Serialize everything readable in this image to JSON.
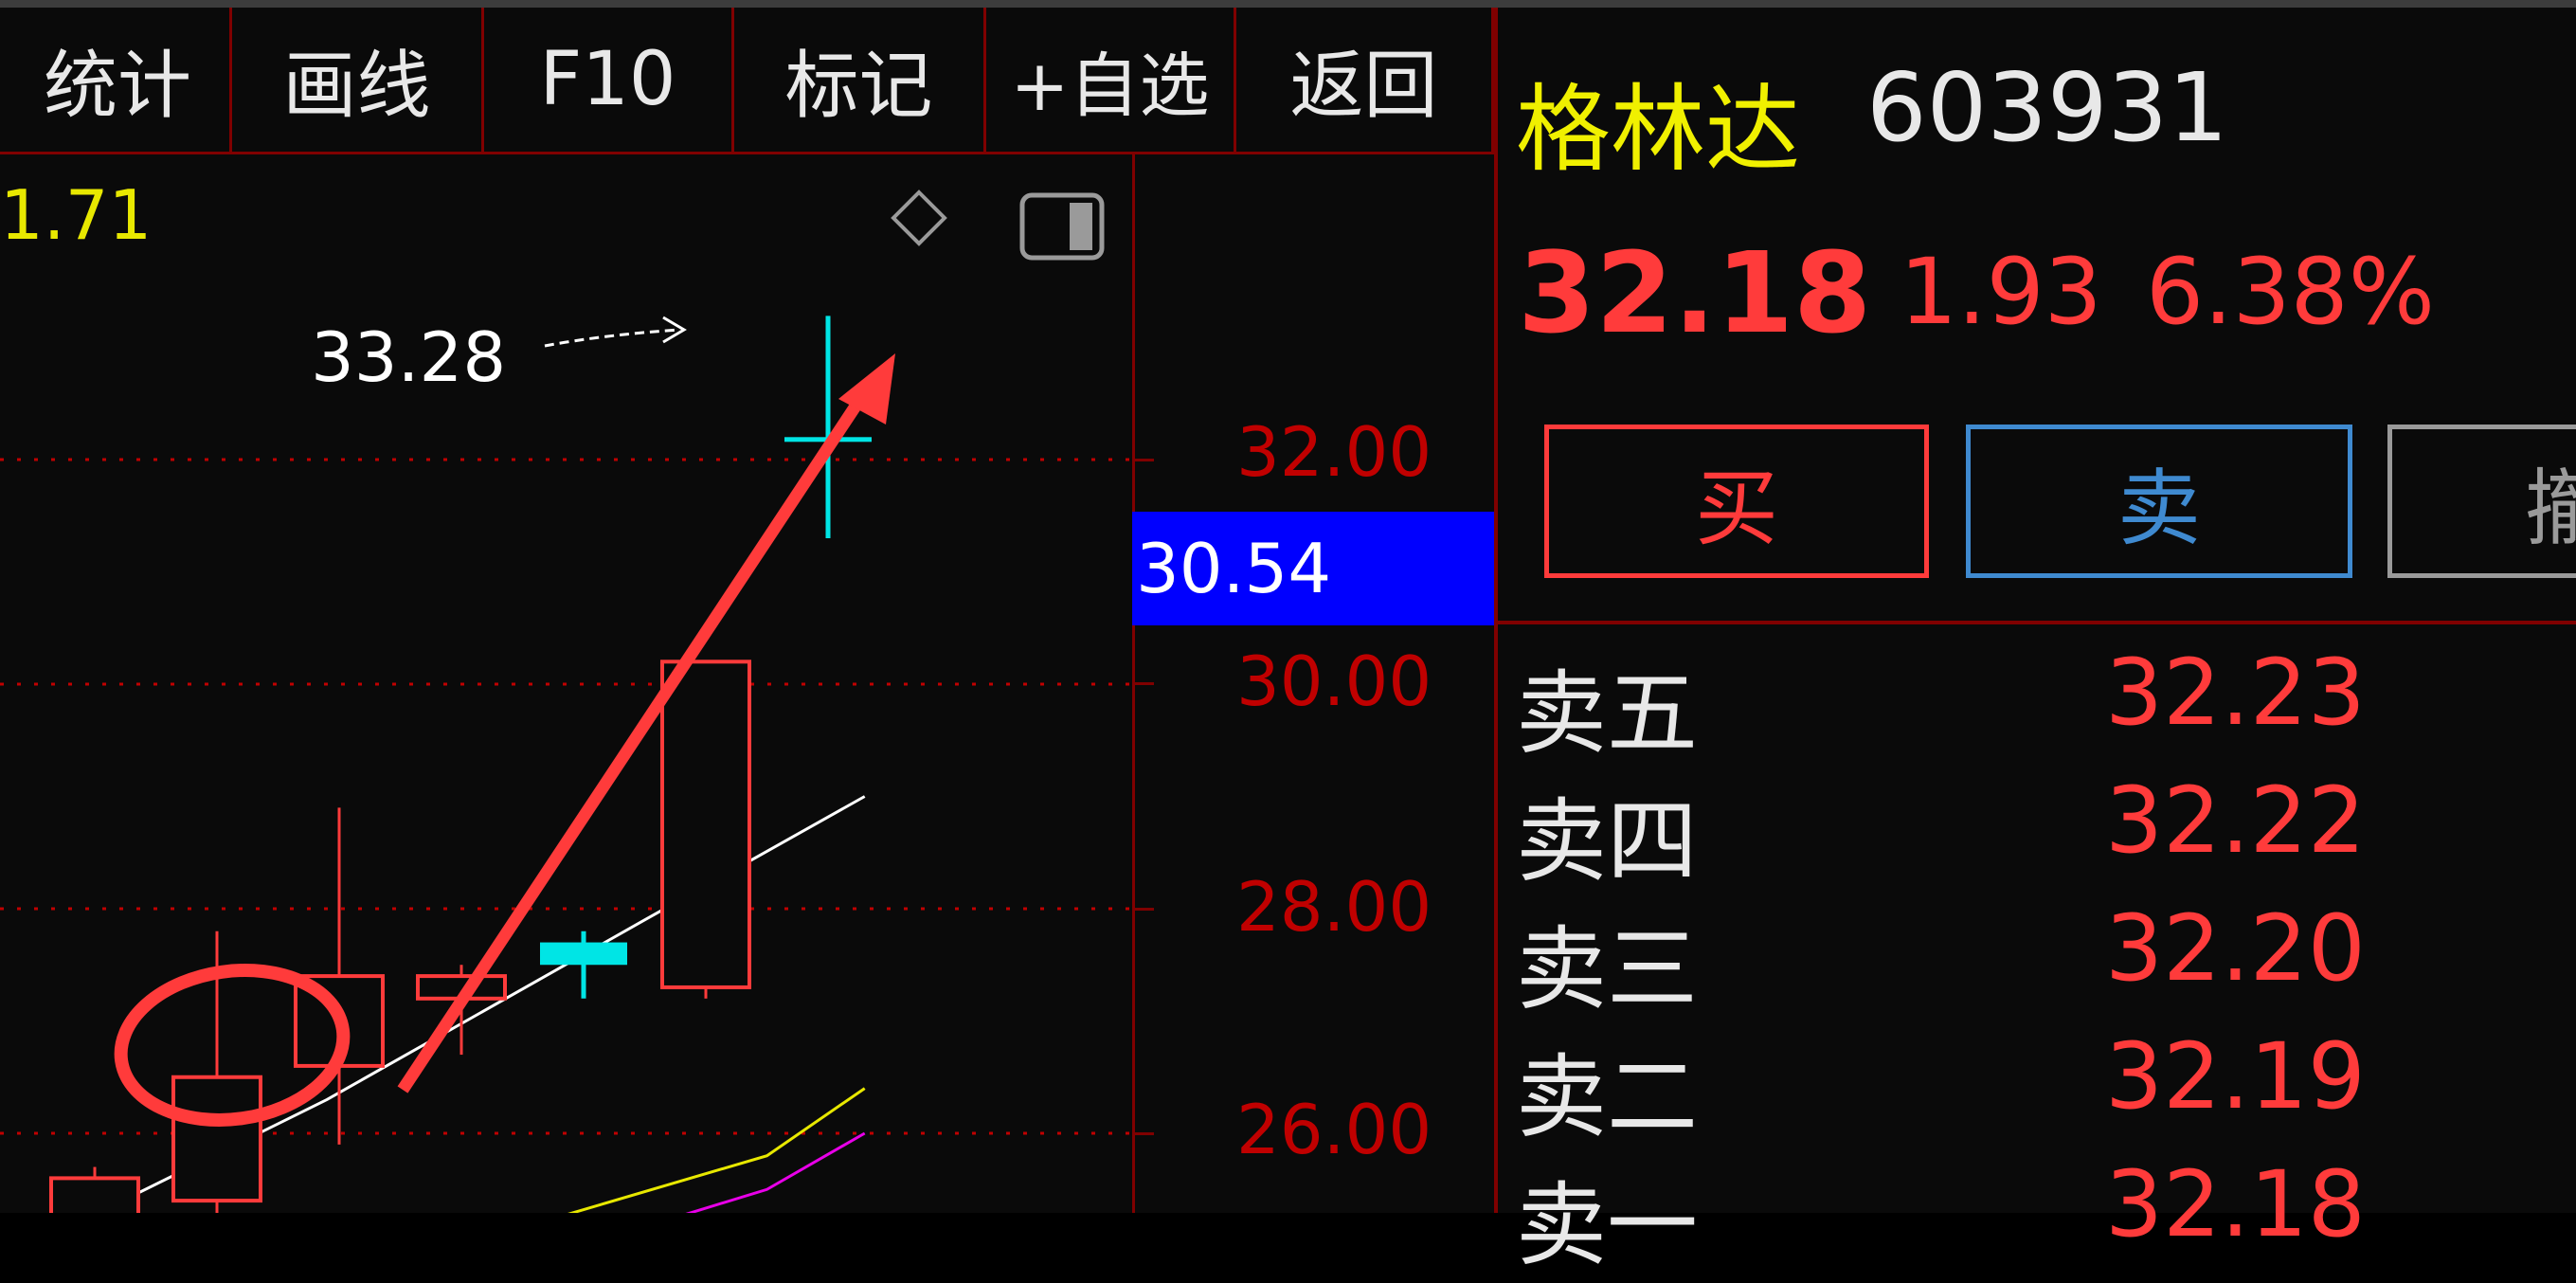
{
  "toolbar": {
    "items": [
      "统计",
      "画线",
      "F10",
      "标记",
      "+自选",
      "返回"
    ]
  },
  "chart": {
    "ma_label": "1.71",
    "high_label": "33.28",
    "current_price_box": "30.54",
    "axis_ticks": [
      "32.00",
      "30.00",
      "28.00",
      "26.00"
    ],
    "icons": [
      "diamond-icon",
      "panel-toggle-icon"
    ]
  },
  "chart_data": {
    "type": "candlestick",
    "ylim": [
      25.4,
      34.3
    ],
    "candles": [
      {
        "open": 25.0,
        "close": 25.6,
        "high": 25.7,
        "low": 24.8,
        "color": "red"
      },
      {
        "open": 25.4,
        "close": 26.5,
        "high": 27.8,
        "low": 25.2,
        "color": "red"
      },
      {
        "open": 26.6,
        "close": 27.4,
        "high": 28.9,
        "low": 25.9,
        "color": "red"
      },
      {
        "open": 27.2,
        "close": 27.4,
        "high": 27.5,
        "low": 26.7,
        "color": "red"
      },
      {
        "open": 27.7,
        "close": 27.5,
        "high": 27.8,
        "low": 27.2,
        "color": "cyan"
      },
      {
        "open": 27.3,
        "close": 30.2,
        "high": 30.2,
        "low": 27.2,
        "color": "red"
      },
      {
        "open": 32.2,
        "close": 32.2,
        "high": 33.28,
        "low": 31.3,
        "color": "cyan"
      }
    ],
    "ma_lines": [
      {
        "color": "#ffffff",
        "points": [
          [
            -0.7,
            24.9
          ],
          [
            1.9,
            26.3
          ],
          [
            4.5,
            27.9
          ],
          [
            6.3,
            29.0
          ]
        ]
      },
      {
        "color": "#e8e800",
        "points": [
          [
            3.0,
            25.0
          ],
          [
            5.5,
            25.8
          ],
          [
            6.3,
            26.4
          ]
        ]
      },
      {
        "color": "#e800e8",
        "points": [
          [
            4.0,
            25.0
          ],
          [
            5.5,
            25.5
          ],
          [
            6.3,
            26.0
          ]
        ]
      },
      {
        "color": "#c0c0c0",
        "points": [
          [
            4.0,
            24.9
          ],
          [
            5.5,
            25.1
          ],
          [
            6.3,
            25.2
          ]
        ]
      }
    ]
  },
  "quote": {
    "name": "格林达",
    "code": "603931",
    "price": "32.18",
    "change": "1.93",
    "change_pct": "6.38%"
  },
  "actions": {
    "buy": "买",
    "sell": "卖",
    "other": "撤"
  },
  "orderbook": [
    {
      "label": "卖五",
      "price": "32.23"
    },
    {
      "label": "卖四",
      "price": "32.22"
    },
    {
      "label": "卖三",
      "price": "32.20"
    },
    {
      "label": "卖二",
      "price": "32.19"
    },
    {
      "label": "卖一",
      "price": "32.18"
    }
  ],
  "colors": {
    "up": "#ff3b3b",
    "down": "#00e5e5",
    "grid": "#c00000",
    "accent_blue": "#0000ff"
  }
}
